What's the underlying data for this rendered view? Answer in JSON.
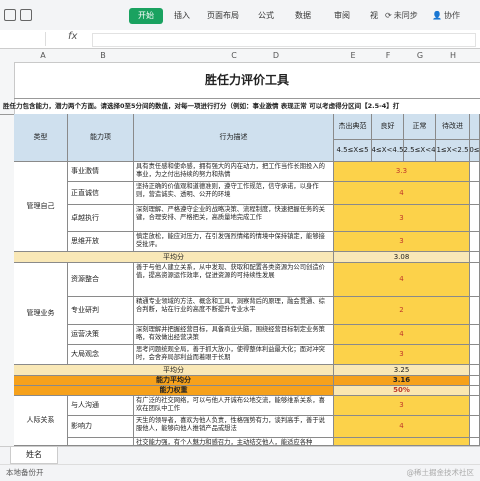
{
  "toolbar": {
    "tabs": [
      "开始",
      "插入",
      "页面布局",
      "公式",
      "数据",
      "审阅",
      "视"
    ],
    "sync_label": "未同步",
    "collab_label": "协作"
  },
  "formula_bar": {
    "cell_ref": "",
    "fx": "fx"
  },
  "columns": [
    "A",
    "B",
    "C",
    "D",
    "E",
    "F",
    "G",
    "H"
  ],
  "sheet": {
    "title": "胜任力评价工具",
    "subtitle": "胜任力包含能力，潜力两个方面。请选择0至5分间的数值，对每一项进行打分（例如：事业激情  表现正常 可以考虑得分区间【2.5-4】打",
    "headers": {
      "type": "类型",
      "ability": "能力项",
      "behavior": "行为描述",
      "levels": [
        "杰出典范",
        "良好",
        "正常",
        "待改进"
      ],
      "ranges": [
        "4.5≤X≤5",
        "4≤X<4.5",
        "2.5≤X<4",
        "1≤X<2.5",
        "0≤"
      ]
    },
    "groups": [
      {
        "category": "管理自己",
        "items": [
          {
            "ability": "事业激情",
            "desc": "具有责任感和使命感，拥有强大的内在动力，把工作当作长期投入的事业，为之付出持续的努力和热情",
            "score": "3.3"
          },
          {
            "ability": "正直诚信",
            "desc": "坚持正确的价值观和道德准则，遵守工作规范，信守承诺，以身作则，营造诚实、透明、公开的环境",
            "score": "4"
          },
          {
            "ability": "卓越执行",
            "desc": "深刻理解、严格遵守企业的战略决策、流程制度，快速把握任务的关键，合理安排、严格把关，高质量地完成工作",
            "score": "3"
          },
          {
            "ability": "思维开放",
            "desc": "慎定放松，能应对压力，在引发强烈情绪的情境中保持镇定，能够接受批评。",
            "score": "3"
          }
        ],
        "avg_label": "平均分",
        "avg_value": "3.08"
      },
      {
        "category": "管理业务",
        "items": [
          {
            "ability": "资源整合",
            "desc": "善于与他人建立关系，从中发现、获取和配置各类资源为公司创造价值，提高资源运作效率，促进资源的可持续性发展",
            "score": "4"
          },
          {
            "ability": "专业研判",
            "desc": "精通专业领域的方法、概念和工具，洞察背后的原理，融会贯通、综合判断，站在行业的高度不断提升专业水平",
            "score": "2"
          },
          {
            "ability": "运营决策",
            "desc": "深刻理解并把握经营目标，具备商业头脑，围绕经营目标制定业务策略，有效做出经营决策",
            "score": "4"
          },
          {
            "ability": "大局观念",
            "desc": "思考问题统观全局，善于抓大放小，使得整体利益最大化；面对冲突时，会舍弃局部利益而着眼于长期",
            "score": "3"
          }
        ],
        "avg_label": "平均分",
        "avg_value": "3.25"
      }
    ],
    "ability_avg": {
      "label": "能力平均分",
      "value": "3.16"
    },
    "ability_weight": {
      "label": "能力权重",
      "value": "50%"
    },
    "group3": {
      "category": "人际关系",
      "items": [
        {
          "ability": "与人沟通",
          "desc": "有广泛的社交网络，可以与他人开诚布公地交流，能够维系关系，喜欢在团队中工作",
          "score": "3"
        },
        {
          "ability": "影响力",
          "desc": "天生的领导者，喜欢为他人负责，性格强势有力，谈判高手，善于说服他人，能够向他人推销产品或想法",
          "score": "4"
        },
        {
          "ability": "",
          "desc": "社交能力强，有个人魅力和感召力，主动结交他人，能适应各种",
          "score": ""
        }
      ]
    }
  },
  "sheet_tab": "姓名",
  "status_bar": {
    "left": "本地备份开",
    "right": "@稀土掘金技术社区"
  }
}
